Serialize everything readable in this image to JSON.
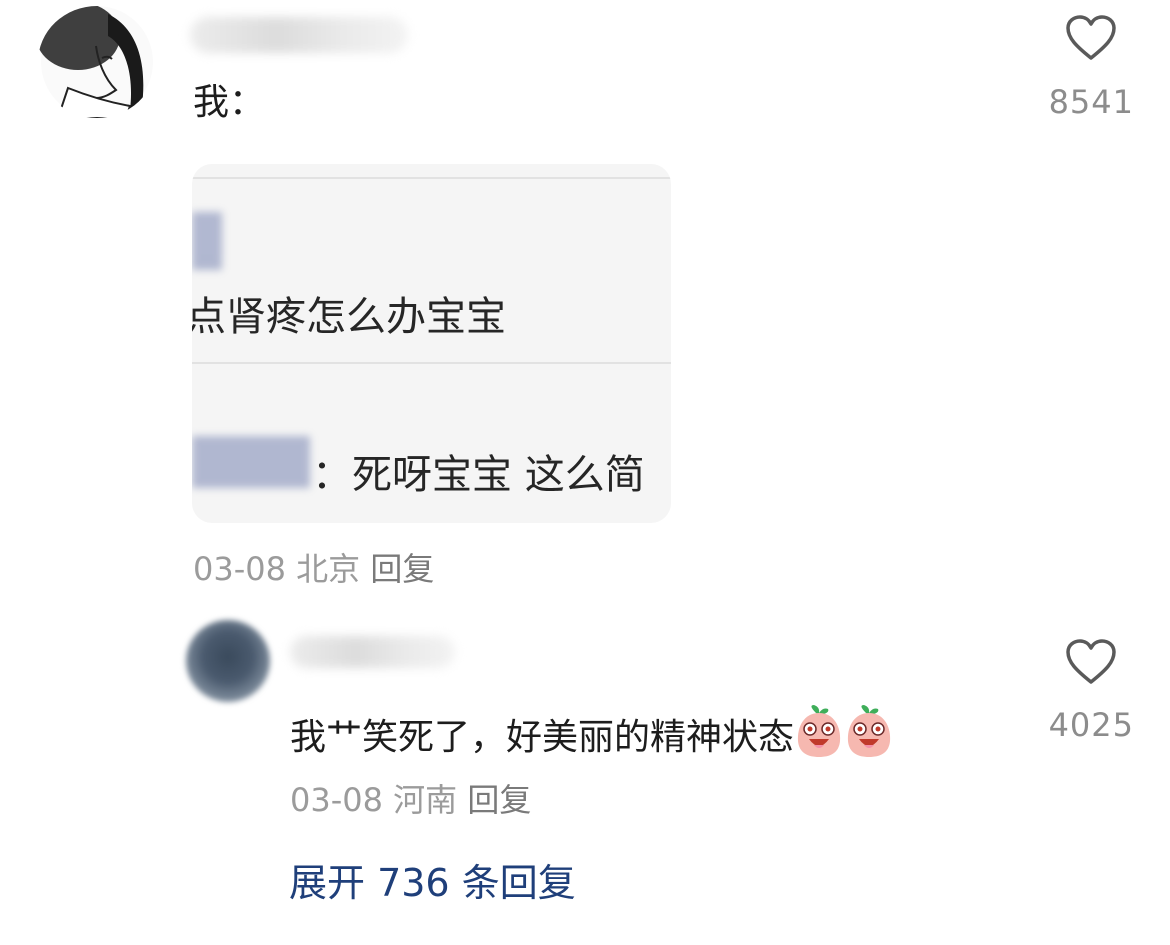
{
  "comment": {
    "text": "我：",
    "like_count": "8541",
    "date": "03-08",
    "location": "北京",
    "reply_label": "回复",
    "quoted_image": {
      "line1": "点肾疼怎么办宝宝",
      "line2": "：死呀宝宝 这么简"
    }
  },
  "reply": {
    "text": "我艹笑死了，好美丽的精神状态",
    "like_count": "4025",
    "date": "03-08",
    "location": "河南",
    "reply_label": "回复"
  },
  "expand_label": "展开 736 条回复",
  "icons": [
    "heart-outline-icon",
    "peach-laughing-emoji-icon"
  ],
  "colors": {
    "link": "#1f3f7a",
    "meta_text": "#9b9b9b",
    "like_count": "#8c8c8c"
  }
}
